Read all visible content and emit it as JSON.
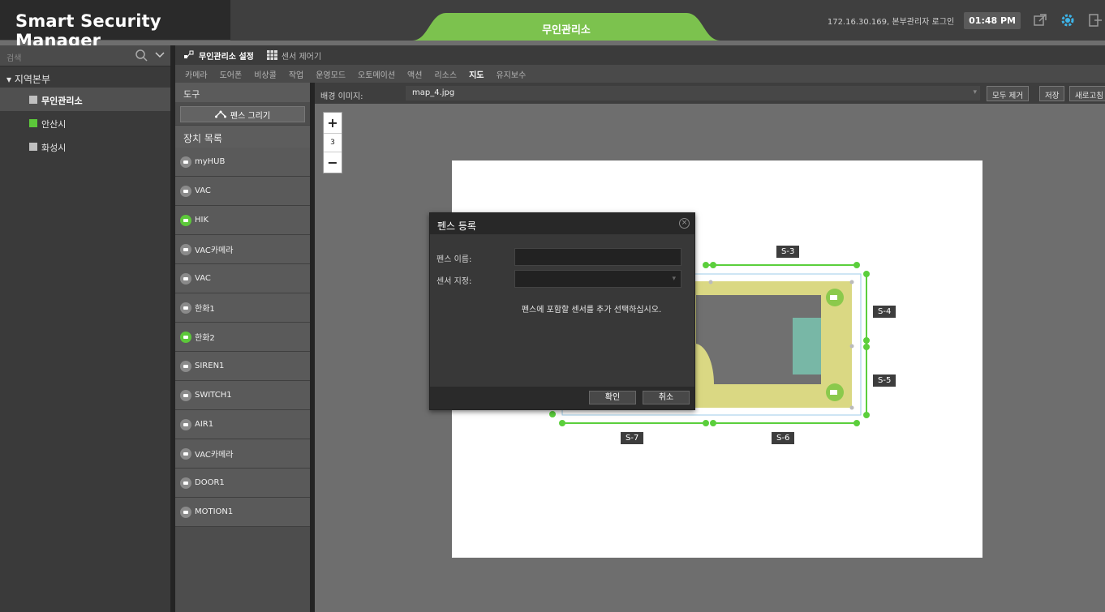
{
  "app": {
    "title": "Smart Security Manager"
  },
  "header": {
    "center_tab": "무인관리소",
    "login_info": "172.16.30.169, 본부관리자 로그인",
    "clock": "01:48 PM"
  },
  "sidebar": {
    "search_placeholder": "검색",
    "root": "▾ 지역본부",
    "items": [
      {
        "label": "무인관리소",
        "color": "#bfbfbf"
      },
      {
        "label": "안산시",
        "color": "#5cc83a"
      },
      {
        "label": "화성시",
        "color": "#bfbfbf"
      }
    ]
  },
  "subtabs": [
    {
      "label": "무인관리소 설정"
    },
    {
      "label": "센서 제어기"
    }
  ],
  "menu": [
    "카메라",
    "도어폰",
    "비상콜",
    "작업",
    "운영모드",
    "오토메이션",
    "액션",
    "리소스",
    "지도",
    "유지보수"
  ],
  "tools": {
    "header": "도구",
    "fence_button": "펜스 그리기",
    "device_list_header": "장치 목록",
    "devices": [
      {
        "name": "myHUB",
        "color": "#8a8a8a"
      },
      {
        "name": "VAC",
        "color": "#8a8a8a"
      },
      {
        "name": "HIK",
        "color": "#5cc83a"
      },
      {
        "name": "VAC카메라",
        "color": "#8a8a8a"
      },
      {
        "name": "VAC",
        "color": "#8a8a8a"
      },
      {
        "name": "한화1",
        "color": "#8a8a8a"
      },
      {
        "name": "한화2",
        "color": "#5cc83a"
      },
      {
        "name": "SIREN1",
        "color": "#8a8a8a"
      },
      {
        "name": "SWITCH1",
        "color": "#8a8a8a"
      },
      {
        "name": "AIR1",
        "color": "#8a8a8a"
      },
      {
        "name": "VAC카메라",
        "color": "#8a8a8a"
      },
      {
        "name": "DOOR1",
        "color": "#8a8a8a"
      },
      {
        "name": "MOTION1",
        "color": "#8a8a8a"
      }
    ]
  },
  "background": {
    "label": "배경 이미지:",
    "value": "map_4.jpg",
    "remove_all": "모두 제거",
    "save": "저장",
    "refresh": "새로고침"
  },
  "zoom": {
    "plus": "+",
    "level": "3",
    "minus": "−"
  },
  "fences": {
    "s3": "S-3",
    "s4": "S-4",
    "s5": "S-5",
    "s6": "S-6",
    "s7": "S-7"
  },
  "dialog": {
    "title": "펜스 등록",
    "name_label": "펜스 이름:",
    "name_value": "",
    "sensor_label": "센서 지정:",
    "sensor_value": "",
    "hint": "펜스에 포함할 센서를 추가 선택하십시오.",
    "ok": "확인",
    "cancel": "취소"
  },
  "colors": {
    "accent": "#6cc24a",
    "fence": "#5bcf3c"
  }
}
